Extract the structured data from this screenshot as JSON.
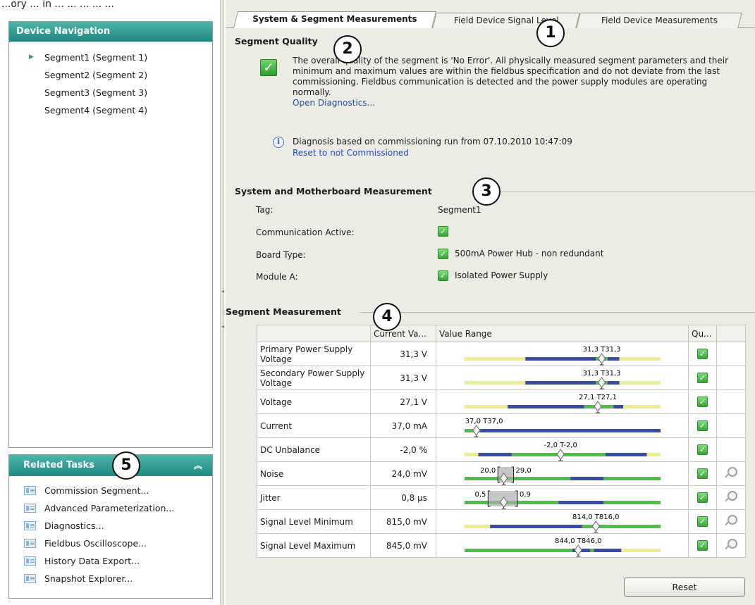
{
  "top_caption": "...ory ... in ... ... ... ... ...",
  "device_nav": {
    "title": "Device Navigation",
    "items": [
      {
        "label": "Segment1 (Segment 1)"
      },
      {
        "label": "Segment2 (Segment 2)"
      },
      {
        "label": "Segment3 (Segment 3)"
      },
      {
        "label": "Segment4 (Segment 4)"
      }
    ]
  },
  "related_tasks": {
    "title": "Related Tasks",
    "items": [
      {
        "label": "Commission Segment..."
      },
      {
        "label": "Advanced Parameterization..."
      },
      {
        "label": "Diagnostics..."
      },
      {
        "label": "Fieldbus Oscilloscope..."
      },
      {
        "label": "History Data Export..."
      },
      {
        "label": "Snapshot Explorer..."
      }
    ]
  },
  "tabs": [
    {
      "label": "System & Segment Measurements"
    },
    {
      "label": "Field Device Signal Level"
    },
    {
      "label": "Field Device Measurements"
    }
  ],
  "callouts": [
    "1",
    "2",
    "3",
    "4",
    "5"
  ],
  "segment_quality": {
    "title": "Segment Quality",
    "text": "The overall quality of the segment is 'No Error'. All physically measured segment parameters and their minimum and maximum values are within the fieldbus specification and do not deviate from the last commissioning. Fieldbus communication is detected and the power supply modules are operating normally.",
    "link": "Open Diagnostics...",
    "diagnosis_text": "Diagnosis based on commissioning run from 07.10.2010 10:47:09",
    "diagnosis_link": "Reset to not Commissioned"
  },
  "system_measurement": {
    "title": "System and Motherboard Measurement",
    "tag_label": "Tag:",
    "tag_value": "Segment1",
    "comm_label": "Communication Active:",
    "board_label": "Board Type:",
    "board_value": "500mA Power Hub - non redundant",
    "module_label": "Module A:",
    "module_value": "Isolated Power Supply"
  },
  "segment_measurement": {
    "title": "Segment Measurement",
    "columns": [
      "Current Va...",
      "Value Range",
      "Qu..."
    ],
    "rows": [
      {
        "name": "Primary Power Supply Voltage",
        "value": "31,3 V",
        "range_label": "31,3 T31,3",
        "marker": 0.7,
        "bands": [
          [
            "y",
            0,
            0.31
          ],
          [
            "b",
            0.31,
            0.79
          ],
          [
            "g",
            0.67,
            0.73
          ],
          [
            "y",
            0.79,
            1
          ]
        ],
        "zoom": false
      },
      {
        "name": "Secondary Power Supply Voltage",
        "value": "31,3 V",
        "range_label": "31,3 T31,3",
        "marker": 0.7,
        "bands": [
          [
            "y",
            0,
            0.31
          ],
          [
            "b",
            0.31,
            0.79
          ],
          [
            "g",
            0.67,
            0.73
          ],
          [
            "y",
            0.79,
            1
          ]
        ],
        "zoom": false
      },
      {
        "name": "Voltage",
        "value": "27,1 V",
        "range_label": "27,1 T27,1",
        "marker": 0.68,
        "bands": [
          [
            "y",
            0,
            0.22
          ],
          [
            "b",
            0.22,
            0.81
          ],
          [
            "g",
            0.61,
            0.76
          ],
          [
            "y",
            0.81,
            1
          ]
        ],
        "zoom": false
      },
      {
        "name": "Current",
        "value": "37,0 mA",
        "range_label": "37,0 T37,0",
        "marker": 0.06,
        "bands": [
          [
            "b",
            0,
            1
          ],
          [
            "g",
            0,
            0.08
          ]
        ],
        "zoom": false
      },
      {
        "name": "DC Unbalance",
        "value": "-2,0 %",
        "range_label": "-2,0 T-2,0",
        "marker": 0.49,
        "bands": [
          [
            "y",
            0,
            0.07
          ],
          [
            "b",
            0.07,
            0.93
          ],
          [
            "g",
            0.24,
            0.72
          ],
          [
            "y",
            0.93,
            1
          ]
        ],
        "zoom": false
      },
      {
        "name": "Noise",
        "value": "24,0 mV",
        "range_label_left": "20,0",
        "range_label_right": "29,0",
        "marker": 0.2,
        "bracket": [
          0.17,
          0.25
        ],
        "bands": [
          [
            "g",
            0,
            0.54
          ],
          [
            "b",
            0.54,
            0.71
          ],
          [
            "g",
            0.71,
            1
          ]
        ],
        "zoom": true
      },
      {
        "name": "Jitter",
        "value": "0,8 µs",
        "range_label_left": "0,5",
        "range_label_right": "0,9",
        "marker": 0.2,
        "bracket": [
          0.12,
          0.27
        ],
        "bands": [
          [
            "g",
            0,
            0.48
          ],
          [
            "b",
            0.48,
            0.71
          ],
          [
            "g",
            0.71,
            1
          ]
        ],
        "zoom": true
      },
      {
        "name": "Signal Level Minimum",
        "value": "815,0 mV",
        "range_label": "814,0 T816,0",
        "marker": 0.67,
        "bands": [
          [
            "y",
            0,
            0.13
          ],
          [
            "b",
            0.13,
            0.6
          ],
          [
            "g",
            0.6,
            1
          ]
        ],
        "zoom": true
      },
      {
        "name": "Signal Level Maximum",
        "value": "845,0 mV",
        "range_label": "844,0 T846,0",
        "marker": 0.58,
        "bands": [
          [
            "g",
            0,
            0.55
          ],
          [
            "b",
            0.55,
            0.8
          ],
          [
            "g",
            0.64,
            0.66
          ],
          [
            "y",
            0.8,
            1
          ]
        ],
        "zoom": true
      }
    ]
  },
  "reset_label": "Reset",
  "colors": {
    "yellow": "#eeee88",
    "blue": "#3a4aa8",
    "green": "#4bbf48",
    "teal_header": "#1e8a80"
  }
}
